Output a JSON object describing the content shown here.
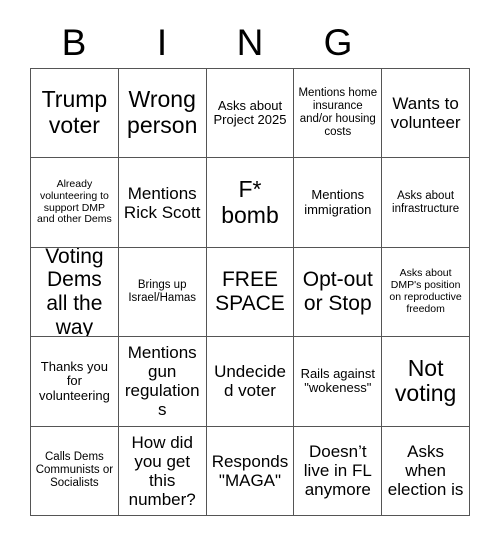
{
  "header": {
    "letters": [
      "B",
      "I",
      "N",
      "G",
      ""
    ]
  },
  "grid": {
    "rows": [
      [
        {
          "text": "Trump voter",
          "size": "s-xl"
        },
        {
          "text": "Wrong person",
          "size": "s-xl"
        },
        {
          "text": "Asks about Project 2025",
          "size": "s-sm"
        },
        {
          "text": "Mentions home insurance and/or housing costs",
          "size": "s-xs"
        },
        {
          "text": "Wants to volunteer",
          "size": "s-md"
        }
      ],
      [
        {
          "text": "Already volunteering to support DMP and other Dems",
          "size": "s-xxs"
        },
        {
          "text": "Mentions Rick Scott",
          "size": "s-md"
        },
        {
          "text": "F* bomb",
          "size": "s-xl"
        },
        {
          "text": "Mentions immigration",
          "size": "s-sm"
        },
        {
          "text": "Asks about infrastructure",
          "size": "s-xs"
        }
      ],
      [
        {
          "text": "Voting Dems all the way",
          "size": "s-lg"
        },
        {
          "text": "Brings up Israel/Hamas",
          "size": "s-xs"
        },
        {
          "text": "FREE SPACE",
          "size": "s-lg"
        },
        {
          "text": "Opt-out or Stop",
          "size": "s-lg"
        },
        {
          "text": "Asks about DMP's position on reproductive freedom",
          "size": "s-xxs"
        }
      ],
      [
        {
          "text": "Thanks you for volunteering",
          "size": "s-sm"
        },
        {
          "text": "Mentions gun regulations",
          "size": "s-md"
        },
        {
          "text": "Undecided voter",
          "size": "s-md"
        },
        {
          "text": "Rails against \"wokeness\"",
          "size": "s-sm"
        },
        {
          "text": "Not voting",
          "size": "s-xl"
        }
      ],
      [
        {
          "text": "Calls Dems Communists or Socialists",
          "size": "s-xs"
        },
        {
          "text": "How did you get this number?",
          "size": "s-md"
        },
        {
          "text": "Responds \"MAGA\"",
          "size": "s-md"
        },
        {
          "text": "Doesn’t live in FL anymore",
          "size": "s-md"
        },
        {
          "text": "Asks when election is",
          "size": "s-md"
        }
      ]
    ]
  }
}
